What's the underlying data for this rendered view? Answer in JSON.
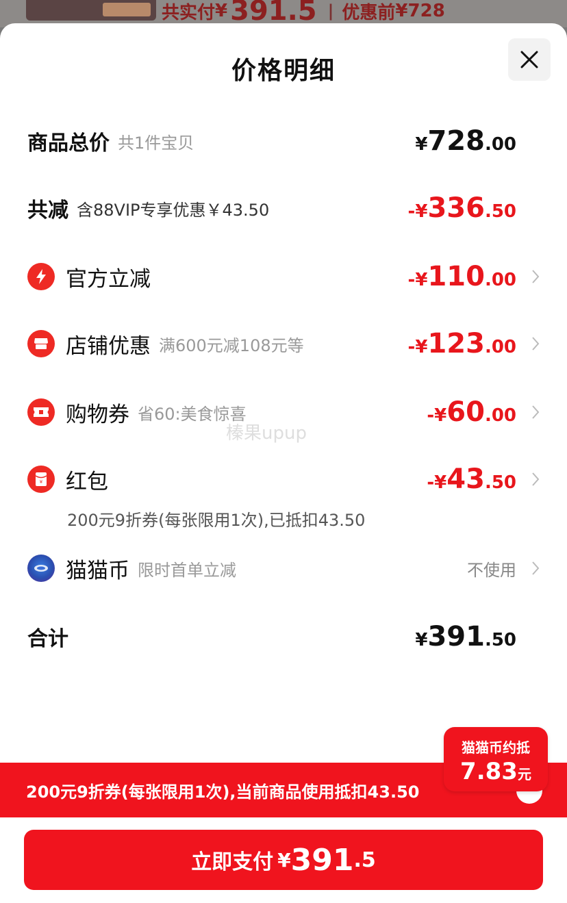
{
  "background": {
    "paid_label": "共实付",
    "paid_symbol": "¥",
    "paid_amount": "391.5",
    "before_label": "优惠前",
    "before_amount": "¥728"
  },
  "sheet": {
    "title": "价格明细",
    "close_icon": "close-icon"
  },
  "rows": {
    "total": {
      "label": "商品总价",
      "sub": "共1件宝贝",
      "sym": "¥",
      "int": "728",
      "dec": ".00"
    },
    "reduce": {
      "label": "共减",
      "sub": "含88VIP专享优惠￥43.50",
      "sym": "-¥",
      "int": "336",
      "dec": ".50"
    },
    "official": {
      "label": "官方立减",
      "sym": "-¥",
      "int": "110",
      "dec": ".00",
      "icon": "lightning-icon"
    },
    "shop": {
      "label": "店铺优惠",
      "sub": "满600元减108元等",
      "sym": "-¥",
      "int": "123",
      "dec": ".00",
      "icon": "shop-icon"
    },
    "voucher": {
      "label": "购物券",
      "sub": "省60:美食惊喜",
      "sym": "-¥",
      "int": "60",
      "dec": ".00",
      "icon": "ticket-icon"
    },
    "redpacket": {
      "label": "红包",
      "sym": "-¥",
      "int": "43",
      "dec": ".50",
      "note": "200元9折券(每张限用1次),已抵扣43.50",
      "icon": "red-packet-icon"
    },
    "catcoin": {
      "label": "猫猫币",
      "sub": "限时首单立减",
      "value": "不使用",
      "icon": "cat-coin-icon"
    },
    "sum": {
      "label": "合计",
      "sym": "¥",
      "int": "391",
      "dec": ".50"
    }
  },
  "watermark": "榛果upup",
  "promo": {
    "text": "200元9折券(每张限用1次),当前商品使用抵扣43.50",
    "badge_line1": "猫猫币约抵",
    "badge_amount": "7.83",
    "badge_unit": "元"
  },
  "pay": {
    "label": "立即支付",
    "sym": "¥",
    "int": "391",
    "dec": ".5"
  },
  "colors": {
    "accent": "#f0141e",
    "discount_red": "#e8161c"
  }
}
